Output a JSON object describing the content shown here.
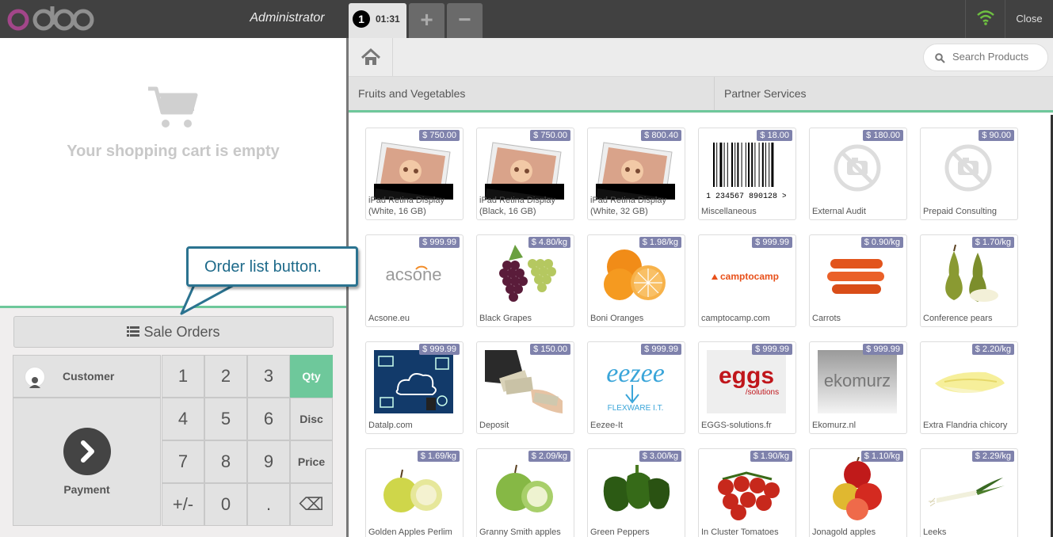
{
  "header": {
    "logo": "odoo",
    "user": "Administrator",
    "order": {
      "number": "1",
      "time": "01:31"
    },
    "add_label": "+",
    "remove_label": "−",
    "close_label": "Close"
  },
  "cart": {
    "empty_text": "Your shopping cart is empty"
  },
  "control": {
    "sale_orders_label": "Sale Orders",
    "customer_label": "Customer",
    "payment_label": "Payment",
    "numpad": [
      "1",
      "2",
      "3",
      "Qty",
      "4",
      "5",
      "6",
      "Disc",
      "7",
      "8",
      "9",
      "Price",
      "+/-",
      "0",
      ".",
      "⌫"
    ]
  },
  "search": {
    "placeholder": "Search Products"
  },
  "categories": [
    "Fruits and Vegetables",
    "Partner Services"
  ],
  "products": [
    {
      "name": "iPad Retina Display (White, 16 GB)",
      "price": "$ 750.00",
      "icon": "ipad"
    },
    {
      "name": "iPad Retina Display (Black, 16 GB)",
      "price": "$ 750.00",
      "icon": "ipad"
    },
    {
      "name": "iPad Retina Display (White, 32 GB)",
      "price": "$ 800.40",
      "icon": "ipad"
    },
    {
      "name": "Miscellaneous",
      "price": "$ 18.00",
      "icon": "barcode"
    },
    {
      "name": "External Audit",
      "price": "$ 180.00",
      "icon": "no-photo"
    },
    {
      "name": "Prepaid Consulting",
      "price": "$ 90.00",
      "icon": "no-photo"
    },
    {
      "name": "Acsone.eu",
      "price": "$ 999.99",
      "icon": "acsone-logo"
    },
    {
      "name": "Black Grapes",
      "price": "$ 4.80/kg",
      "icon": "grapes"
    },
    {
      "name": "Boni Oranges",
      "price": "$ 1.98/kg",
      "icon": "oranges"
    },
    {
      "name": "camptocamp.com",
      "price": "$ 999.99",
      "icon": "camptocamp-logo"
    },
    {
      "name": "Carrots",
      "price": "$ 0.90/kg",
      "icon": "carrots"
    },
    {
      "name": "Conference pears",
      "price": "$ 1.70/kg",
      "icon": "pears"
    },
    {
      "name": "Datalp.com",
      "price": "$ 999.99",
      "icon": "datalp-logo"
    },
    {
      "name": "Deposit",
      "price": "$ 150.00",
      "icon": "money"
    },
    {
      "name": "Eezee-It",
      "price": "$ 999.99",
      "icon": "eezee-logo"
    },
    {
      "name": "EGGS-solutions.fr",
      "price": "$ 999.99",
      "icon": "eggs-logo"
    },
    {
      "name": "Ekomurz.nl",
      "price": "$ 999.99",
      "icon": "ekomurz-logo"
    },
    {
      "name": "Extra Flandria chicory",
      "price": "$ 2.20/kg",
      "icon": "chicory"
    },
    {
      "name": "Golden Apples Perlim",
      "price": "$ 1.69/kg",
      "icon": "golden-apples"
    },
    {
      "name": "Granny Smith apples",
      "price": "$ 2.09/kg",
      "icon": "green-apples"
    },
    {
      "name": "Green Peppers",
      "price": "$ 3.00/kg",
      "icon": "green-peppers"
    },
    {
      "name": "In Cluster Tomatoes",
      "price": "$ 1.90/kg",
      "icon": "tomatoes"
    },
    {
      "name": "Jonagold apples",
      "price": "$ 1.10/kg",
      "icon": "red-apples"
    },
    {
      "name": "Leeks",
      "price": "$ 2.29/kg",
      "icon": "leeks"
    }
  ],
  "images": {
    "acsone": "acsone",
    "camptocamp": "camptocamp",
    "eezee": "eezee",
    "flexware": "FLEXWARE I.T.",
    "eggs": "eggs",
    "eggs_sub": "/solutions",
    "ekomurz": "ekomurz",
    "barcode_digits": "1 234567 890128 >"
  },
  "annotation": {
    "text": "Order list button."
  },
  "colors": {
    "accent": "#6ec89b",
    "price_badge": "#7f82ac",
    "topbar": "#414141",
    "callout_border": "#2b7390"
  }
}
